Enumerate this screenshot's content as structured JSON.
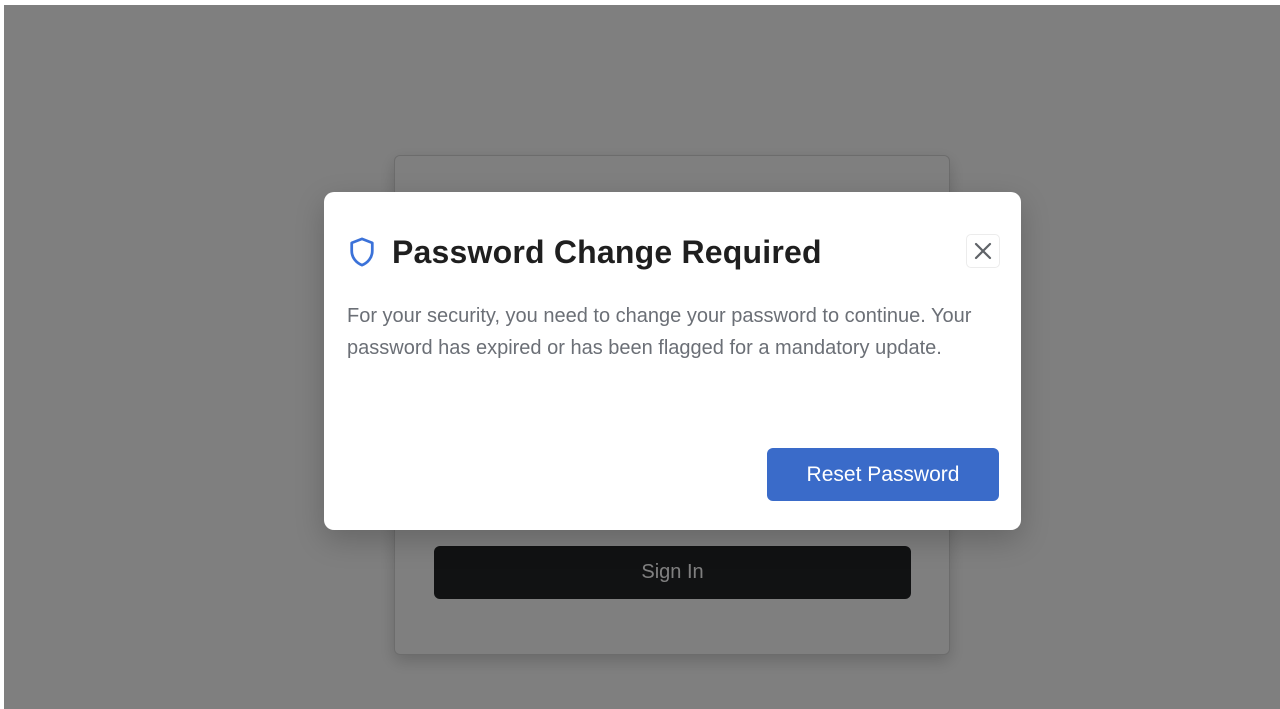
{
  "login": {
    "signin_label": "Sign In"
  },
  "modal": {
    "title": "Password Change Required",
    "title_icon": "shield-icon",
    "close_icon": "close-icon",
    "body": "For your security, you need to change your password to continue. Your password has expired or has been flagged for a mandatory update.",
    "primary_action_label": "Reset Password"
  },
  "colors": {
    "overlay": "#808080",
    "accent": "#3a6bc9",
    "shield": "#3b72d9",
    "signin_button": "#232427",
    "title_text": "#1f1f1f",
    "body_text": "#6b6f76"
  }
}
